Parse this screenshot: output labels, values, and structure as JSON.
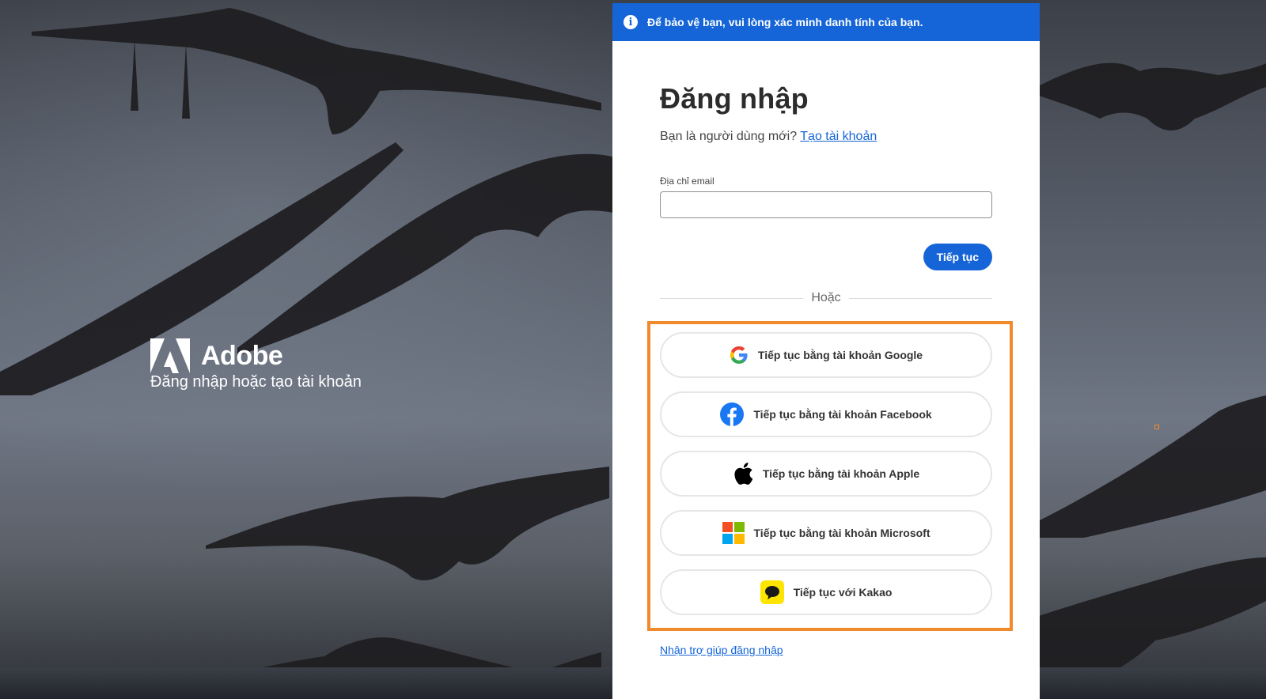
{
  "banner": {
    "text": "Để bảo vệ bạn, vui lòng xác minh danh tính của bạn."
  },
  "brand": {
    "name": "Adobe",
    "subtitle": "Đăng nhập hoặc tạo tài khoản"
  },
  "form": {
    "title": "Đăng nhập",
    "new_user_prompt": "Bạn là người dùng mới?",
    "create_account_link": "Tạo tài khoản",
    "email_label": "Địa chỉ email",
    "email_value": "",
    "continue_label": "Tiếp tục",
    "or_text": "Hoặc",
    "help_link": "Nhận trợ giúp đăng nhập"
  },
  "social": [
    {
      "label": "Tiếp tục bằng tài khoản Google",
      "icon": "google-icon"
    },
    {
      "label": "Tiếp tục bằng tài khoản Facebook",
      "icon": "facebook-icon"
    },
    {
      "label": "Tiếp tục bằng tài khoản Apple",
      "icon": "apple-icon"
    },
    {
      "label": "Tiếp tục bằng tài khoản Microsoft",
      "icon": "microsoft-icon"
    },
    {
      "label": "Tiếp tục với Kakao",
      "icon": "kakao-icon"
    }
  ],
  "colors": {
    "primary": "#1565d8",
    "highlight": "#f08a2c"
  }
}
